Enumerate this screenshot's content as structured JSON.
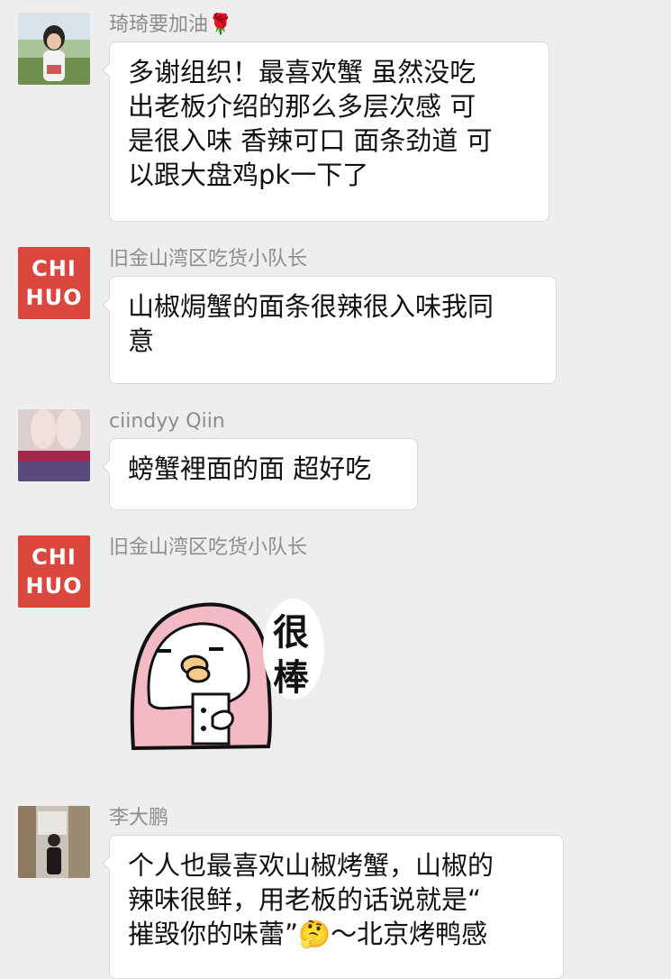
{
  "messages": [
    {
      "sender": "琦琦要加油",
      "sender_emoji": "🌹",
      "avatar": "photo-avatar-girl",
      "lines": [
        "多谢组织！最喜欢蟹 虽然没吃",
        "出老板介绍的那么多层次感 可",
        "是很入味 香辣可口 面条劲道 可",
        "以跟大盘鸡pk一下了"
      ]
    },
    {
      "sender": "旧金山湾区吃货小队长",
      "avatar": "chihuo-logo",
      "logo_text": [
        "CHI",
        "HUO"
      ],
      "lines": [
        "山椒焗蟹的面条很辣很入味我同",
        "意"
      ]
    },
    {
      "sender": "ciindyy Qiin",
      "avatar": "photo-avatar-legs",
      "lines": [
        "螃蟹裡面的面 超好吃"
      ]
    },
    {
      "sender": "旧金山湾区吃货小队长",
      "avatar": "chihuo-logo",
      "logo_text": [
        "CHI",
        "HUO"
      ],
      "sticker_text": [
        "很",
        "棒"
      ]
    },
    {
      "sender": "李大鹏",
      "avatar": "photo-avatar-man",
      "lines": [
        "个人也最喜欢山椒烤蟹，山椒的",
        "辣味很鲜，用老板的话说就是“",
        "摧毁你的味蕾”🤔～北京烤鸭感"
      ]
    }
  ],
  "colors": {
    "background": "#eeeeee",
    "bubble": "#ffffff",
    "sender_text": "#8d8d8d",
    "chihuo_red": "#d9473f",
    "sticker_pink": "#f3b9c4"
  }
}
